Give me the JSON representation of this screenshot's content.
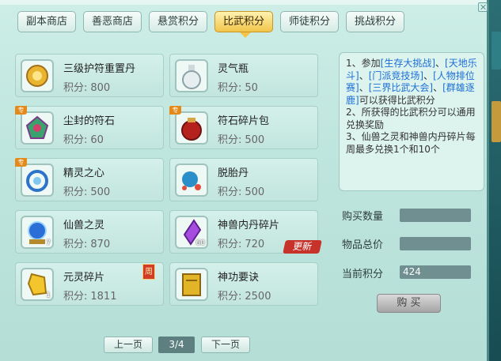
{
  "tabs": [
    {
      "label": "副本商店"
    },
    {
      "label": "善恶商店"
    },
    {
      "label": "悬赏积分"
    },
    {
      "label": "比武积分"
    },
    {
      "label": "师徒积分"
    },
    {
      "label": "挑战积分"
    }
  ],
  "active_tab": "比武积分",
  "points_prefix": "积分:",
  "items": [
    {
      "name": "三级护符重置丹",
      "points": "800",
      "icon": "golden-pill-icon"
    },
    {
      "name": "灵气瓶",
      "points": "50",
      "icon": "spirit-bottle-icon"
    },
    {
      "name": "尘封的符石",
      "points": "60",
      "icon": "rune-stone-icon",
      "ribbon": "专"
    },
    {
      "name": "符石碎片包",
      "points": "500",
      "icon": "rune-shard-bag-icon",
      "ribbon": "专"
    },
    {
      "name": "精灵之心",
      "points": "500",
      "icon": "spirit-heart-icon",
      "ribbon": "专"
    },
    {
      "name": "脱胎丹",
      "points": "500",
      "icon": "rebirth-pill-icon"
    },
    {
      "name": "仙兽之灵",
      "points": "870",
      "icon": "beast-spirit-orb-icon",
      "qty": "7"
    },
    {
      "name": "神兽内丹碎片",
      "points": "720",
      "icon": "beast-core-shard-icon",
      "qty": "60",
      "badge": "更新"
    },
    {
      "name": "元灵碎片",
      "points": "1811",
      "icon": "essence-shard-icon",
      "qty": "1",
      "badge": "周"
    },
    {
      "name": "神功要诀",
      "points": "2500",
      "icon": "skill-book-icon"
    }
  ],
  "description": {
    "parts": [
      {
        "text": "1、参加",
        "hl": false
      },
      {
        "text": "[生存大挑战]",
        "hl": true
      },
      {
        "text": "、",
        "hl": false
      },
      {
        "text": "[天地乐斗]",
        "hl": true
      },
      {
        "text": "、",
        "hl": false
      },
      {
        "text": "[门派竞技场]",
        "hl": true
      },
      {
        "text": "、",
        "hl": false
      },
      {
        "text": "[人物排位赛]",
        "hl": true
      },
      {
        "text": "、",
        "hl": false
      },
      {
        "text": "[三界比武大会]",
        "hl": true
      },
      {
        "text": "、",
        "hl": false
      },
      {
        "text": "[群雄逐鹿]",
        "hl": true
      },
      {
        "text": "可以获得比武积分",
        "hl": false
      }
    ],
    "line2": "2、所获得的比武积分可以通用兑换奖励",
    "line3": "3、仙兽之灵和神兽内丹碎片每周最多兑换1个和10个"
  },
  "purchase": {
    "qty_label": "购买数量",
    "qty_value": "",
    "total_label": "物品总价",
    "total_value": "",
    "current_label": "当前积分",
    "current_value": "424",
    "buy_label": "购 买"
  },
  "pagination": {
    "prev": "上一页",
    "page": "3/4",
    "next": "下一页"
  }
}
